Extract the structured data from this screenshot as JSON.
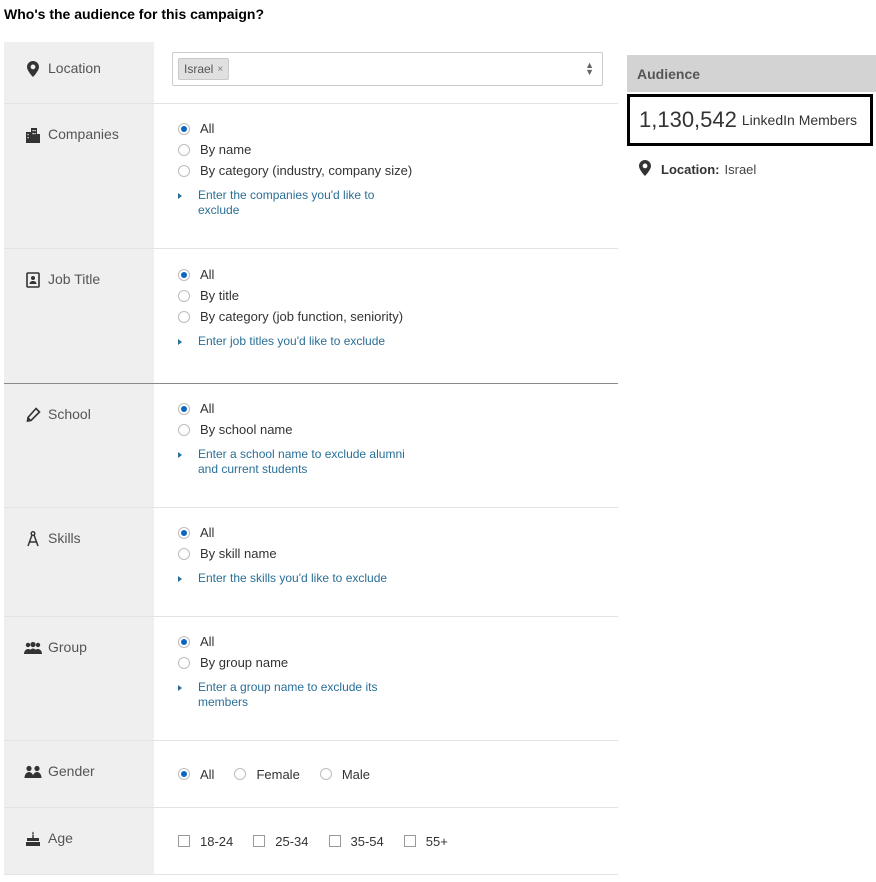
{
  "page_title": "Who's the audience for this campaign?",
  "criteria": {
    "location": {
      "label": "Location",
      "icon": "location-pin-icon",
      "tag": "Israel",
      "tag_remove": "×"
    },
    "companies": {
      "label": "Companies",
      "icon": "building-icon",
      "options": [
        "All",
        "By name",
        "By category (industry, company size)"
      ],
      "selected": 0,
      "exclude": "Enter the companies you'd like to exclude"
    },
    "job_title": {
      "label": "Job Title",
      "icon": "badge-icon",
      "options": [
        "All",
        "By title",
        "By category (job function, seniority)"
      ],
      "selected": 0,
      "exclude": "Enter job titles you'd like to exclude"
    },
    "school": {
      "label": "School",
      "icon": "pen-icon",
      "options": [
        "All",
        "By school name"
      ],
      "selected": 0,
      "exclude": "Enter a school name to exclude alumni and current students"
    },
    "skills": {
      "label": "Skills",
      "icon": "compass-icon",
      "options": [
        "All",
        "By skill name"
      ],
      "selected": 0,
      "exclude": "Enter the skills you'd like to exclude"
    },
    "group": {
      "label": "Group",
      "icon": "group-icon",
      "options": [
        "All",
        "By group name"
      ],
      "selected": 0,
      "exclude": "Enter a group name to exclude its members"
    },
    "gender": {
      "label": "Gender",
      "icon": "people-icon",
      "options": [
        "All",
        "Female",
        "Male"
      ],
      "selected": 0
    },
    "age": {
      "label": "Age",
      "icon": "cake-icon",
      "options": [
        "18-24",
        "25-34",
        "35-54",
        "55+"
      ]
    }
  },
  "audience": {
    "header": "Audience",
    "count": "1,130,542",
    "count_label": "LinkedIn Members",
    "location_key": "Location:",
    "location_value": "Israel"
  },
  "colors": {
    "accent": "#0a66c2",
    "link": "#2a6f97",
    "label_bg": "#efefef",
    "audience_header_bg": "#d3d3d3"
  }
}
